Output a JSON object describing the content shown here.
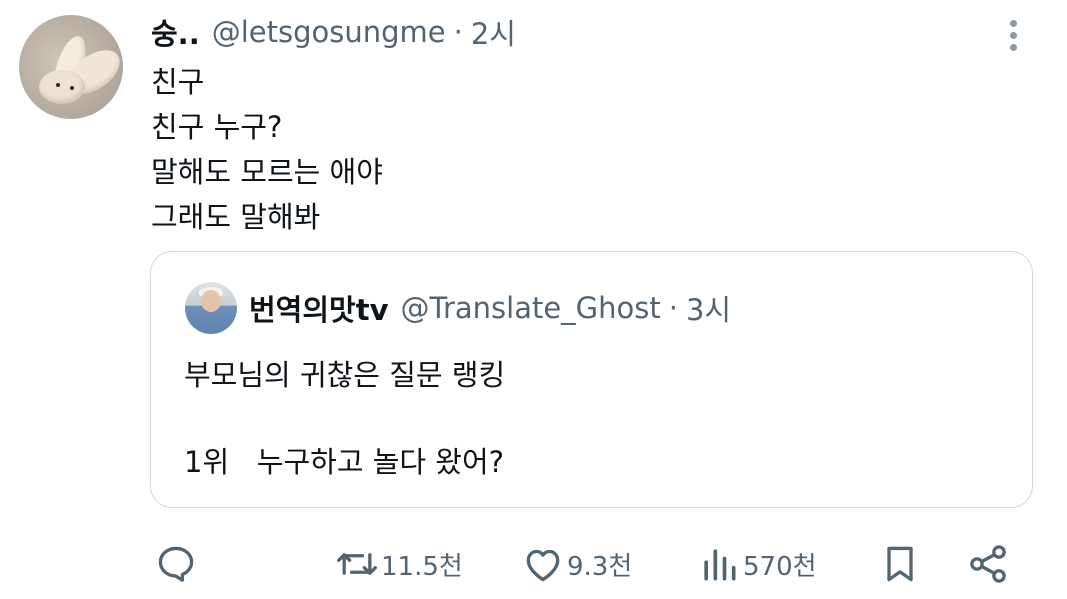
{
  "tweet": {
    "author_name": "숭..",
    "author_handle": "@letsgosungme",
    "separator": "·",
    "time": "2시",
    "lines": [
      "친구",
      "친구 누구?",
      "말해도 모르는 애야",
      "그래도 말해봐"
    ]
  },
  "quote": {
    "author_name": "번역의맛tv",
    "author_handle": "@Translate_Ghost",
    "separator": "·",
    "time": "3시",
    "line1": "부모님의 귀찮은 질문 랭킹",
    "line2": "1위   누구하고 놀다 왔어?"
  },
  "actions": {
    "reply": {
      "icon": "reply-icon"
    },
    "retweet": {
      "icon": "retweet-icon",
      "count": "11.5천"
    },
    "like": {
      "icon": "heart-icon",
      "count": "9.3천"
    },
    "views": {
      "icon": "views-icon",
      "count": "570천"
    },
    "bookmark": {
      "icon": "bookmark-icon"
    },
    "share": {
      "icon": "share-icon"
    }
  },
  "colors": {
    "text": "#0f1419",
    "secondary": "#536471",
    "border": "#cfd9de"
  }
}
